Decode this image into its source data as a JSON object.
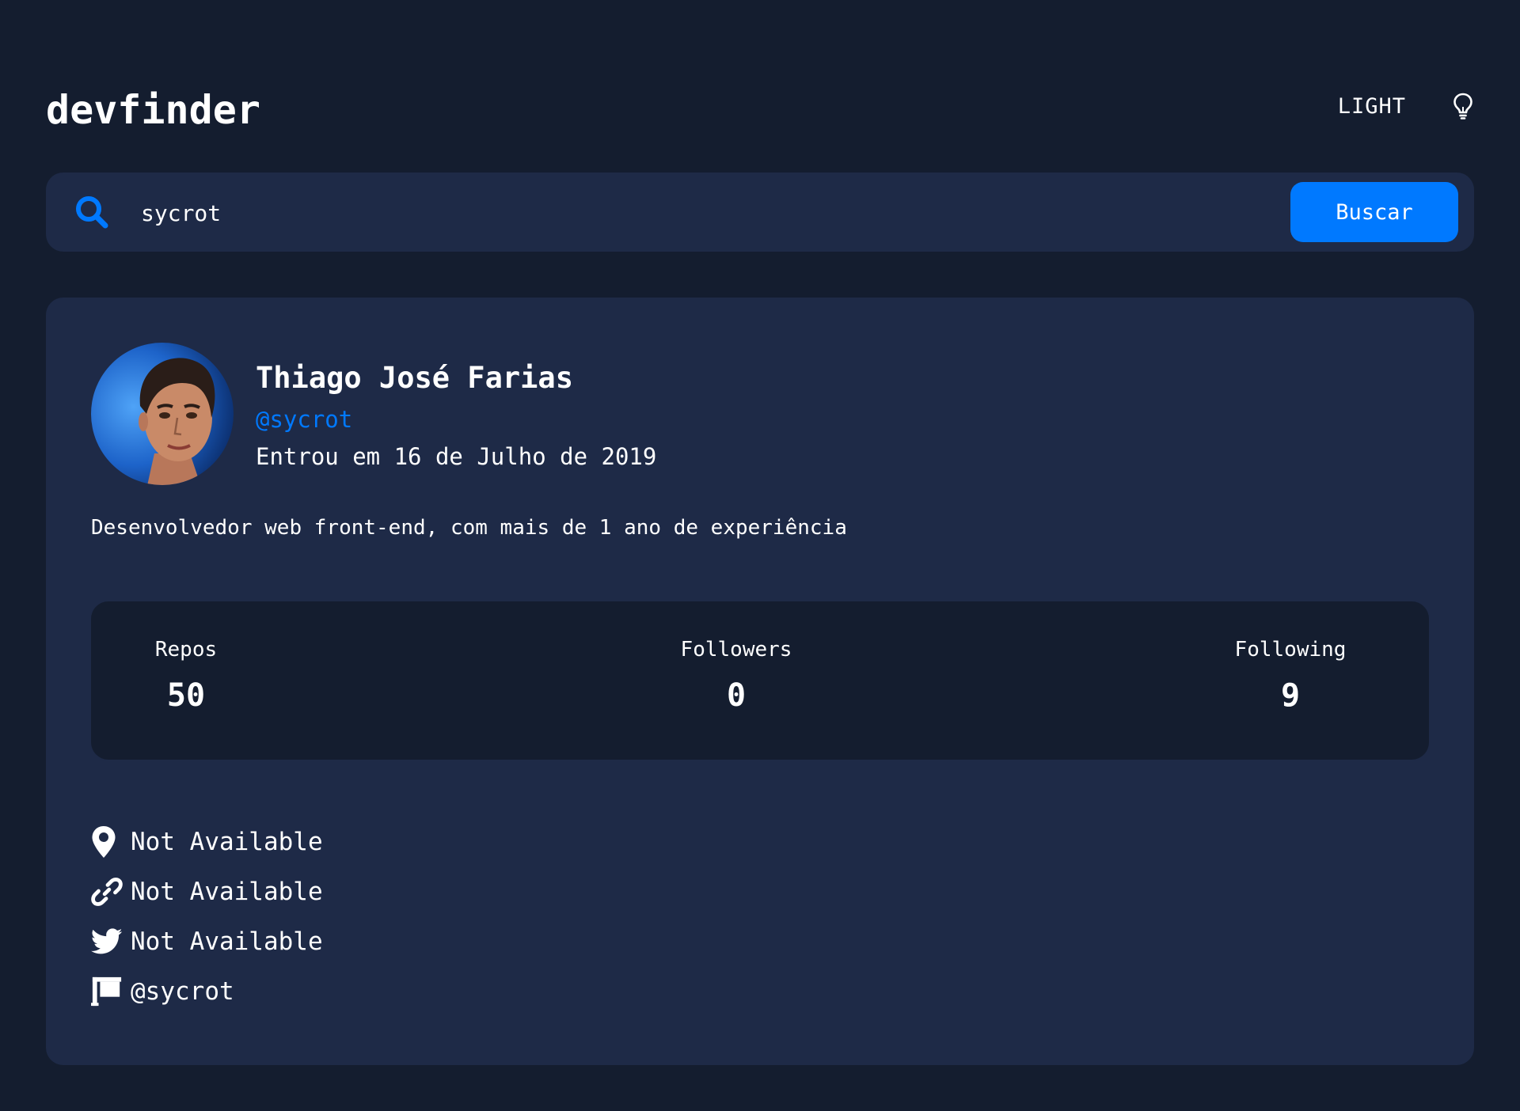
{
  "header": {
    "logo": "devfinder",
    "theme_label": "LIGHT",
    "theme_icon": "lightbulb-icon"
  },
  "search": {
    "value": "sycrot",
    "placeholder": "",
    "icon": "search-icon",
    "button_label": "Buscar"
  },
  "profile": {
    "name": "Thiago José Farias",
    "username": "@sycrot",
    "joined": "Entrou em 16 de Julho de 2019",
    "bio": "Desenvolvedor web front-end, com mais de 1 ano de experiência",
    "stats": {
      "repos_label": "Repos",
      "repos_value": "50",
      "followers_label": "Followers",
      "followers_value": "0",
      "following_label": "Following",
      "following_value": "9"
    },
    "links": {
      "location": {
        "icon": "location-pin-icon",
        "text": "Not Available"
      },
      "website": {
        "icon": "link-icon",
        "text": "Not Available"
      },
      "twitter": {
        "icon": "twitter-icon",
        "text": "Not Available"
      },
      "company": {
        "icon": "company-icon",
        "text": "@sycrot"
      }
    }
  },
  "colors": {
    "background": "#141d2f",
    "card": "#1e2a47",
    "accent": "#0079ff",
    "text": "#ffffff"
  }
}
